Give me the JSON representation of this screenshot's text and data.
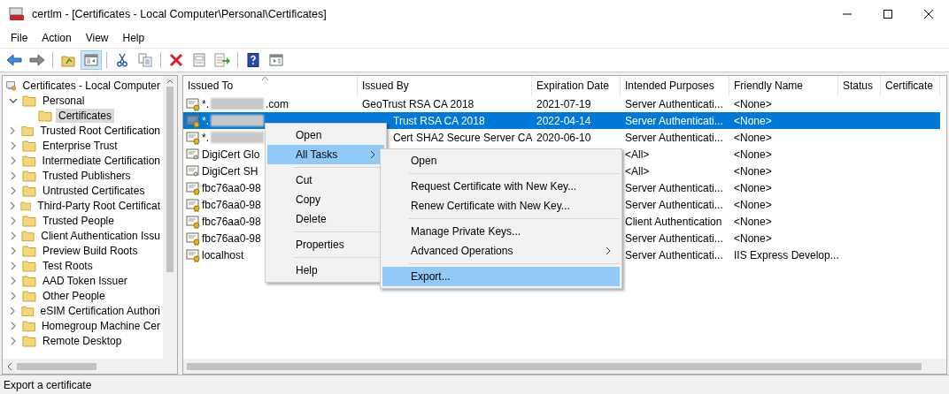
{
  "window": {
    "title": "certlm - [Certificates - Local Computer\\Personal\\Certificates]"
  },
  "menu_bar": [
    "File",
    "Action",
    "View",
    "Help"
  ],
  "toolbar": [
    {
      "kind": "back",
      "pressed": false
    },
    {
      "kind": "forward",
      "pressed": false
    },
    {
      "kind": "separator"
    },
    {
      "kind": "up",
      "pressed": false
    },
    {
      "kind": "console-tree",
      "pressed": true
    },
    {
      "kind": "separator"
    },
    {
      "kind": "cut",
      "pressed": false
    },
    {
      "kind": "copy",
      "pressed": false
    },
    {
      "kind": "separator"
    },
    {
      "kind": "delete",
      "pressed": false
    },
    {
      "kind": "properties",
      "pressed": false
    },
    {
      "kind": "export",
      "pressed": false
    },
    {
      "kind": "separator"
    },
    {
      "kind": "help",
      "pressed": false
    },
    {
      "kind": "action-pane",
      "pressed": false
    }
  ],
  "tree": {
    "label": "Certificates - Local Computer",
    "selected": false,
    "children": [
      {
        "label": "Personal",
        "expanded": true,
        "selected": false,
        "children": [
          {
            "label": "Certificates",
            "selected": true
          }
        ]
      },
      {
        "label": "Trusted Root Certification",
        "expanded": false,
        "selected": false
      },
      {
        "label": "Enterprise Trust",
        "expanded": false,
        "selected": false
      },
      {
        "label": "Intermediate Certification",
        "expanded": false,
        "selected": false
      },
      {
        "label": "Trusted Publishers",
        "expanded": false,
        "selected": false
      },
      {
        "label": "Untrusted Certificates",
        "expanded": false,
        "selected": false
      },
      {
        "label": "Third-Party Root Certificat",
        "expanded": false,
        "selected": false
      },
      {
        "label": "Trusted People",
        "expanded": false,
        "selected": false
      },
      {
        "label": "Client Authentication Issu",
        "expanded": false,
        "selected": false
      },
      {
        "label": "Preview Build Roots",
        "expanded": false,
        "selected": false
      },
      {
        "label": "Test Roots",
        "expanded": false,
        "selected": false
      },
      {
        "label": "AAD Token Issuer",
        "expanded": false,
        "selected": false
      },
      {
        "label": "Other People",
        "expanded": false,
        "selected": false
      },
      {
        "label": "eSIM Certification Authori",
        "expanded": false,
        "selected": false
      },
      {
        "label": "Homegroup Machine Cer",
        "expanded": false,
        "selected": false
      },
      {
        "label": "Remote Desktop",
        "expanded": false,
        "selected": false
      }
    ]
  },
  "table": {
    "columns": [
      {
        "label": "Issued To",
        "sorted": true
      },
      {
        "label": "Issued By",
        "sorted": false
      },
      {
        "label": "Expiration Date",
        "sorted": false
      },
      {
        "label": "Intended Purposes",
        "sorted": false
      },
      {
        "label": "Friendly Name",
        "sorted": false
      },
      {
        "label": "Status",
        "sorted": false
      },
      {
        "label": "Certificate",
        "sorted": false
      }
    ],
    "rows": [
      {
        "issued_to": {
          "prefix": "*.",
          "redacted": true,
          "suffix": ".com"
        },
        "issued_by": "GeoTrust RSA CA 2018",
        "covered_left": false,
        "expiration": "2021-07-19",
        "purposes": "Server Authenticati...",
        "friendly_name": "<None>",
        "has_key": true,
        "selected": false
      },
      {
        "issued_to": {
          "prefix": "*.",
          "redacted": true
        },
        "issued_by": "Trust RSA CA 2018",
        "covered_left": true,
        "expiration": "2022-04-14",
        "purposes": "Server Authenticati...",
        "friendly_name": "<None>",
        "has_key": true,
        "selected": true
      },
      {
        "issued_to": {
          "prefix": "*.",
          "redacted": true
        },
        "issued_by": "Cert SHA2 Secure Server CA",
        "covered_left": true,
        "expiration": "2020-06-10",
        "purposes": "Server Authenticati...",
        "friendly_name": "<None>",
        "has_key": true,
        "selected": false
      },
      {
        "issued_to": {
          "prefix": "DigiCert Glo",
          "redacted": false
        },
        "purposes": "<All>",
        "friendly_name": "<None>",
        "has_key": false,
        "selected": false
      },
      {
        "issued_to": {
          "prefix": "DigiCert SH",
          "redacted": false
        },
        "purposes": "<All>",
        "friendly_name": "<None>",
        "has_key": false,
        "selected": false
      },
      {
        "issued_to": {
          "prefix": "fbc76aa0-98",
          "redacted": false
        },
        "purposes": "Server Authenticati...",
        "friendly_name": "<None>",
        "has_key": true,
        "selected": false
      },
      {
        "issued_to": {
          "prefix": "fbc76aa0-98",
          "redacted": false
        },
        "purposes": "Server Authenticati...",
        "friendly_name": "<None>",
        "has_key": true,
        "selected": false
      },
      {
        "issued_to": {
          "prefix": "fbc76aa0-98",
          "redacted": false
        },
        "purposes": "Client Authentication",
        "friendly_name": "<None>",
        "has_key": true,
        "selected": false
      },
      {
        "issued_to": {
          "prefix": "fbc76aa0-98",
          "redacted": false
        },
        "purposes": "Server Authenticati...",
        "friendly_name": "<None>",
        "has_key": true,
        "selected": false
      },
      {
        "issued_to": {
          "prefix": "localhost",
          "redacted": false
        },
        "purposes": "Server Authenticati...",
        "friendly_name": "IIS Express Develop...",
        "has_key": true,
        "selected": false
      }
    ]
  },
  "context_menu": [
    {
      "kind": "item",
      "label": "Open",
      "selected": false
    },
    {
      "kind": "item",
      "label": "All Tasks",
      "selected": true,
      "submenu": true
    },
    {
      "kind": "separator"
    },
    {
      "kind": "item",
      "label": "Cut",
      "selected": false
    },
    {
      "kind": "item",
      "label": "Copy",
      "selected": false
    },
    {
      "kind": "item",
      "label": "Delete",
      "selected": false
    },
    {
      "kind": "separator"
    },
    {
      "kind": "item",
      "label": "Properties",
      "selected": false
    },
    {
      "kind": "separator"
    },
    {
      "kind": "item",
      "label": "Help",
      "selected": false
    }
  ],
  "submenu": [
    {
      "kind": "item",
      "label": "Open",
      "selected": false
    },
    {
      "kind": "separator"
    },
    {
      "kind": "item",
      "label": "Request Certificate with New Key...",
      "selected": false
    },
    {
      "kind": "item",
      "label": "Renew Certificate with New Key...",
      "selected": false
    },
    {
      "kind": "separator"
    },
    {
      "kind": "item",
      "label": "Manage Private Keys...",
      "selected": false
    },
    {
      "kind": "item",
      "label": "Advanced Operations",
      "selected": false,
      "submenu": true
    },
    {
      "kind": "separator"
    },
    {
      "kind": "item",
      "label": "Export...",
      "selected": true
    }
  ],
  "status_bar": "Export a certificate"
}
